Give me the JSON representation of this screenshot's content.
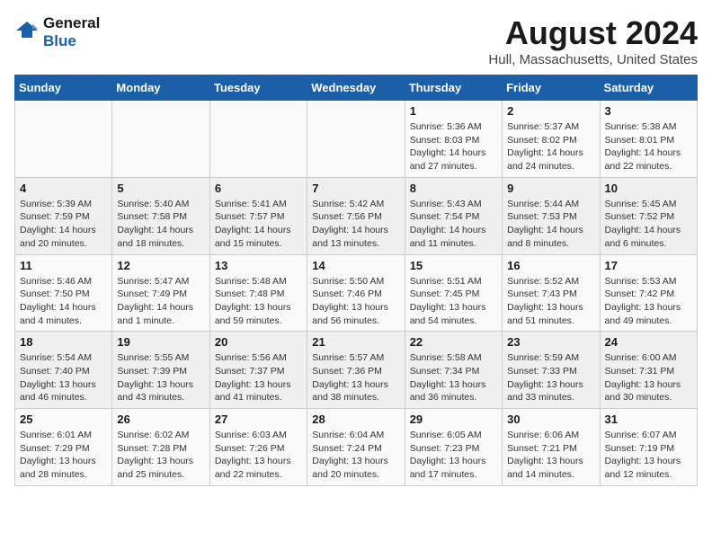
{
  "logo": {
    "line1": "General",
    "line2": "Blue"
  },
  "title": "August 2024",
  "subtitle": "Hull, Massachusetts, United States",
  "days_of_week": [
    "Sunday",
    "Monday",
    "Tuesday",
    "Wednesday",
    "Thursday",
    "Friday",
    "Saturday"
  ],
  "weeks": [
    [
      {
        "day": "",
        "info": ""
      },
      {
        "day": "",
        "info": ""
      },
      {
        "day": "",
        "info": ""
      },
      {
        "day": "",
        "info": ""
      },
      {
        "day": "1",
        "info": "Sunrise: 5:36 AM\nSunset: 8:03 PM\nDaylight: 14 hours and 27 minutes."
      },
      {
        "day": "2",
        "info": "Sunrise: 5:37 AM\nSunset: 8:02 PM\nDaylight: 14 hours and 24 minutes."
      },
      {
        "day": "3",
        "info": "Sunrise: 5:38 AM\nSunset: 8:01 PM\nDaylight: 14 hours and 22 minutes."
      }
    ],
    [
      {
        "day": "4",
        "info": "Sunrise: 5:39 AM\nSunset: 7:59 PM\nDaylight: 14 hours and 20 minutes."
      },
      {
        "day": "5",
        "info": "Sunrise: 5:40 AM\nSunset: 7:58 PM\nDaylight: 14 hours and 18 minutes."
      },
      {
        "day": "6",
        "info": "Sunrise: 5:41 AM\nSunset: 7:57 PM\nDaylight: 14 hours and 15 minutes."
      },
      {
        "day": "7",
        "info": "Sunrise: 5:42 AM\nSunset: 7:56 PM\nDaylight: 14 hours and 13 minutes."
      },
      {
        "day": "8",
        "info": "Sunrise: 5:43 AM\nSunset: 7:54 PM\nDaylight: 14 hours and 11 minutes."
      },
      {
        "day": "9",
        "info": "Sunrise: 5:44 AM\nSunset: 7:53 PM\nDaylight: 14 hours and 8 minutes."
      },
      {
        "day": "10",
        "info": "Sunrise: 5:45 AM\nSunset: 7:52 PM\nDaylight: 14 hours and 6 minutes."
      }
    ],
    [
      {
        "day": "11",
        "info": "Sunrise: 5:46 AM\nSunset: 7:50 PM\nDaylight: 14 hours and 4 minutes."
      },
      {
        "day": "12",
        "info": "Sunrise: 5:47 AM\nSunset: 7:49 PM\nDaylight: 14 hours and 1 minute."
      },
      {
        "day": "13",
        "info": "Sunrise: 5:48 AM\nSunset: 7:48 PM\nDaylight: 13 hours and 59 minutes."
      },
      {
        "day": "14",
        "info": "Sunrise: 5:50 AM\nSunset: 7:46 PM\nDaylight: 13 hours and 56 minutes."
      },
      {
        "day": "15",
        "info": "Sunrise: 5:51 AM\nSunset: 7:45 PM\nDaylight: 13 hours and 54 minutes."
      },
      {
        "day": "16",
        "info": "Sunrise: 5:52 AM\nSunset: 7:43 PM\nDaylight: 13 hours and 51 minutes."
      },
      {
        "day": "17",
        "info": "Sunrise: 5:53 AM\nSunset: 7:42 PM\nDaylight: 13 hours and 49 minutes."
      }
    ],
    [
      {
        "day": "18",
        "info": "Sunrise: 5:54 AM\nSunset: 7:40 PM\nDaylight: 13 hours and 46 minutes."
      },
      {
        "day": "19",
        "info": "Sunrise: 5:55 AM\nSunset: 7:39 PM\nDaylight: 13 hours and 43 minutes."
      },
      {
        "day": "20",
        "info": "Sunrise: 5:56 AM\nSunset: 7:37 PM\nDaylight: 13 hours and 41 minutes."
      },
      {
        "day": "21",
        "info": "Sunrise: 5:57 AM\nSunset: 7:36 PM\nDaylight: 13 hours and 38 minutes."
      },
      {
        "day": "22",
        "info": "Sunrise: 5:58 AM\nSunset: 7:34 PM\nDaylight: 13 hours and 36 minutes."
      },
      {
        "day": "23",
        "info": "Sunrise: 5:59 AM\nSunset: 7:33 PM\nDaylight: 13 hours and 33 minutes."
      },
      {
        "day": "24",
        "info": "Sunrise: 6:00 AM\nSunset: 7:31 PM\nDaylight: 13 hours and 30 minutes."
      }
    ],
    [
      {
        "day": "25",
        "info": "Sunrise: 6:01 AM\nSunset: 7:29 PM\nDaylight: 13 hours and 28 minutes."
      },
      {
        "day": "26",
        "info": "Sunrise: 6:02 AM\nSunset: 7:28 PM\nDaylight: 13 hours and 25 minutes."
      },
      {
        "day": "27",
        "info": "Sunrise: 6:03 AM\nSunset: 7:26 PM\nDaylight: 13 hours and 22 minutes."
      },
      {
        "day": "28",
        "info": "Sunrise: 6:04 AM\nSunset: 7:24 PM\nDaylight: 13 hours and 20 minutes."
      },
      {
        "day": "29",
        "info": "Sunrise: 6:05 AM\nSunset: 7:23 PM\nDaylight: 13 hours and 17 minutes."
      },
      {
        "day": "30",
        "info": "Sunrise: 6:06 AM\nSunset: 7:21 PM\nDaylight: 13 hours and 14 minutes."
      },
      {
        "day": "31",
        "info": "Sunrise: 6:07 AM\nSunset: 7:19 PM\nDaylight: 13 hours and 12 minutes."
      }
    ]
  ]
}
